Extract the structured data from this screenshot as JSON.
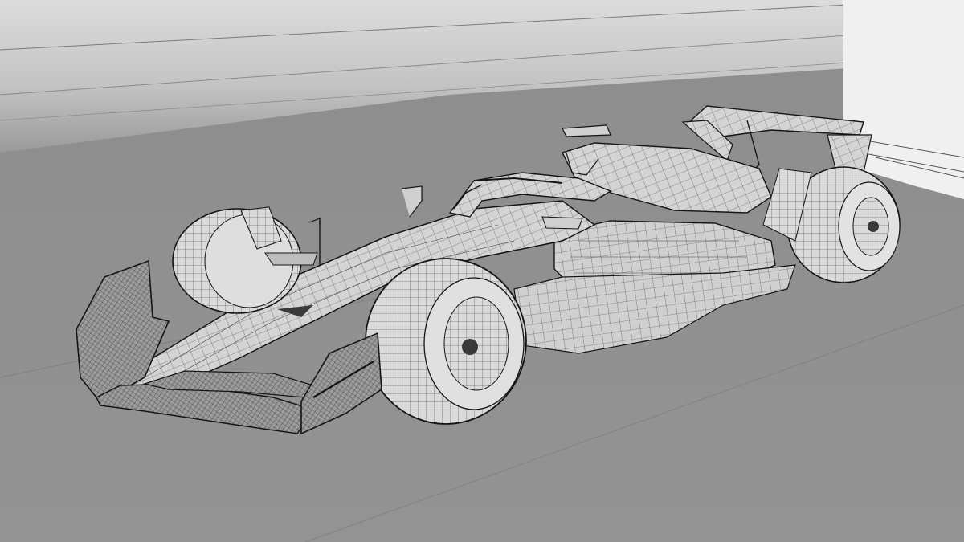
{
  "scene": {
    "subject": "formula-one-car-wireframe-render",
    "colors": {
      "floor": "#8c8c8c",
      "wall_light": "#e6e6e6",
      "wall_shadow": "#a9a9a9",
      "panel": "#efefef",
      "mesh": "#2a2a2a",
      "surface": "#d4d4d4"
    }
  }
}
